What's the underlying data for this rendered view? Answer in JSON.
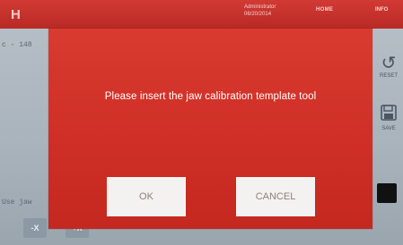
{
  "topbar": {
    "logo": "H",
    "user_line1": "Administrator",
    "user_line2": "06/20/2014",
    "home_label": "HOME",
    "info_label": "INFO"
  },
  "background": {
    "readout": "c - 148",
    "hint": "Use jaw",
    "jog_minus": "-X",
    "jog_plus": "+X",
    "reset_label": "RESET",
    "save_label": "SAVE",
    "reset_icon": "undo-icon",
    "save_icon": "floppy-disk-icon"
  },
  "dialog": {
    "message": "Please insert the jaw calibration template tool",
    "ok_label": "OK",
    "cancel_label": "CANCEL",
    "background_color": "#d0322a"
  }
}
